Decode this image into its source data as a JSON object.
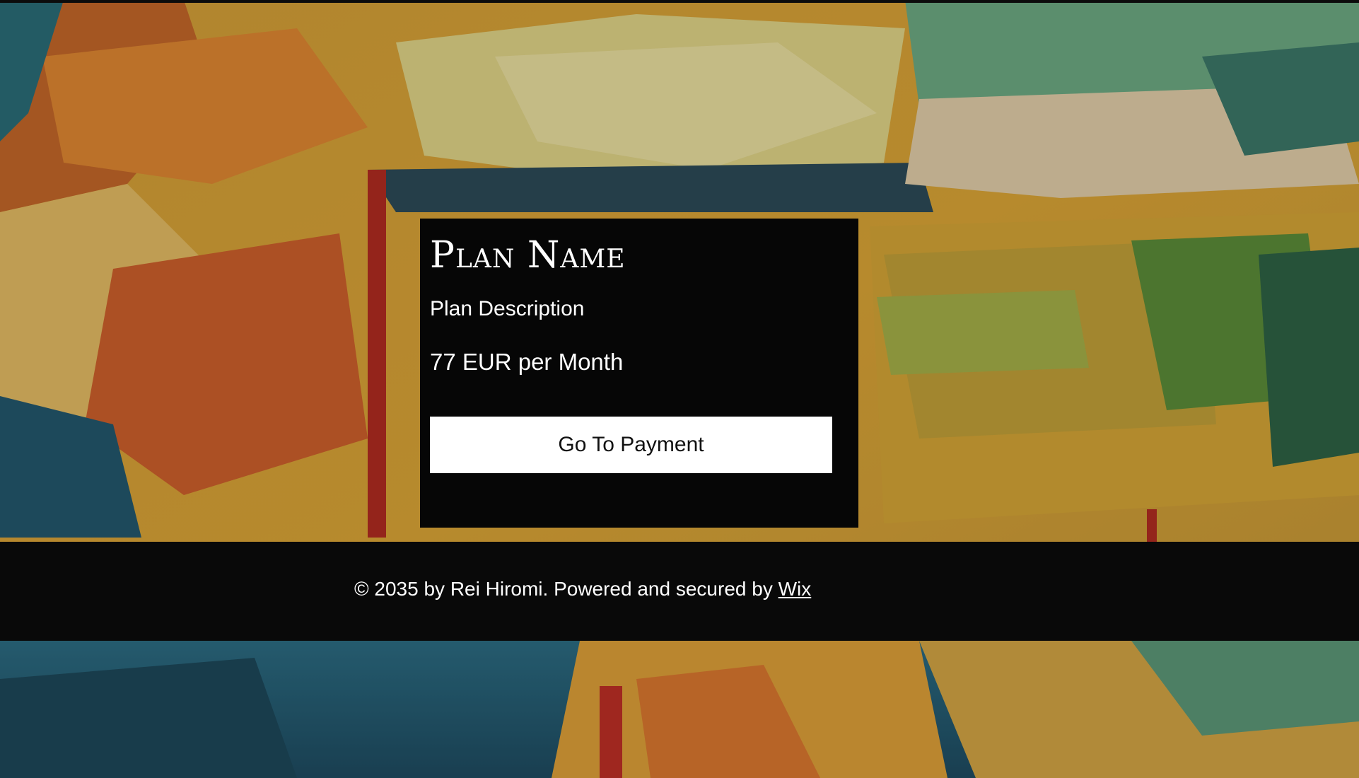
{
  "plan": {
    "name": "Plan Name",
    "description": "Plan Description",
    "price": "77 EUR per Month",
    "button_label": "Go To Payment"
  },
  "footer": {
    "text": "© 2035 by Rei Hiromi. Powered and secured by",
    "link_label": "Wix"
  },
  "colors": {
    "card_background": "#060606",
    "button_background": "#ffffff",
    "footer_background": "#090909",
    "text": "#ffffff"
  },
  "icons": {
    "background": "abstract-painting-image"
  }
}
